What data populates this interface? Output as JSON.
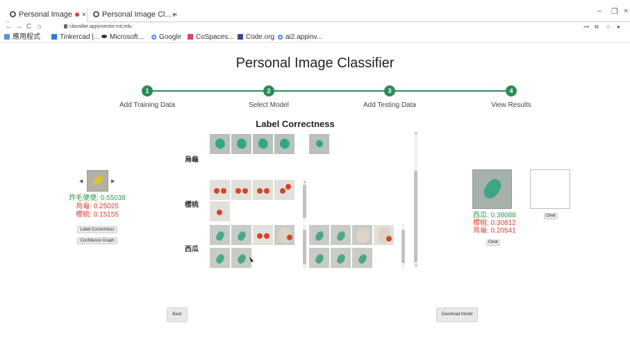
{
  "browser": {
    "tabs": [
      {
        "title": "Personal Image",
        "close": "×"
      },
      {
        "title": "Personal Image Cl...",
        "close": "×"
      }
    ],
    "new_tab": "+",
    "window_controls": [
      "–",
      "❐",
      "×"
    ],
    "nav": [
      "←",
      "→",
      "C",
      "⌂"
    ],
    "url": "classifier.appinventor.mit.edu",
    "bookmarks": [
      "應用程式",
      "Tinkercad |...",
      "Microsoft...",
      "Google",
      "CoSpaces...",
      "Code.org",
      "ai2.appinv..."
    ]
  },
  "page": {
    "title": "Personal Image Classifier"
  },
  "steps": [
    {
      "number": "1",
      "label": "Add Training Data"
    },
    {
      "number": "2",
      "label": "Select Model"
    },
    {
      "number": "3",
      "label": "Add Testing Data"
    },
    {
      "number": "4",
      "label": "View Results"
    }
  ],
  "section_title": "Label Correctness",
  "left_panel": {
    "prev_arrow": "◀",
    "next_arrow": "▶",
    "predictions": [
      {
        "text": "炸毛便便: 0.55038",
        "color": "#2e9950"
      },
      {
        "text": "烏龜: 0.25025",
        "color": "#d9402f"
      },
      {
        "text": "櫻桃: 0.15155",
        "color": "#d9402f"
      }
    ],
    "label_correctness_button": "Label Correctness",
    "confidence_graph_button": "Confidence Graph"
  },
  "grid": {
    "rows": [
      {
        "label": "烏龜"
      },
      {
        "label": "櫻桃"
      },
      {
        "label": "西瓜"
      }
    ]
  },
  "right_panel": {
    "predictions": [
      {
        "text": "西瓜: 0.38088",
        "color": "#2e9950"
      },
      {
        "text": "櫻桃: 0.30812",
        "color": "#d9402f"
      },
      {
        "text": "烏龜: 0.20541",
        "color": "#d9402f"
      }
    ],
    "clear_below_image": "Clear",
    "clear_canvas": "Clear"
  },
  "footer": {
    "back_button": "Back",
    "download_button": "Download Model"
  }
}
